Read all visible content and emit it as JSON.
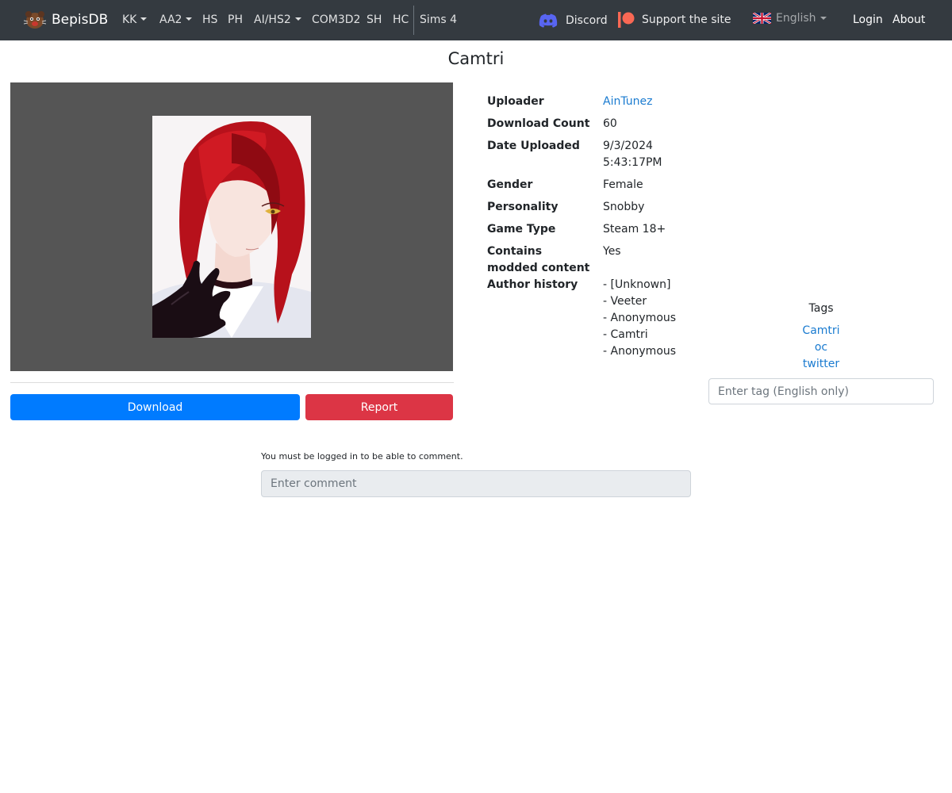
{
  "navbar": {
    "brand": "BepisDB",
    "items": [
      {
        "label": "KK",
        "dropdown": true
      },
      {
        "label": "AA2",
        "dropdown": true
      },
      {
        "label": "HS",
        "dropdown": false
      },
      {
        "label": "PH",
        "dropdown": false
      },
      {
        "label": "AI/HS2",
        "dropdown": true
      },
      {
        "label": "COM3D2",
        "dropdown": false
      },
      {
        "label": "SH",
        "dropdown": false
      },
      {
        "label": "HC",
        "dropdown": false
      },
      {
        "label": "Sims 4",
        "dropdown": false
      }
    ],
    "discord_label": "Discord",
    "support_label": "Support the site",
    "language": "English",
    "login_label": "Login",
    "about_label": "About"
  },
  "card": {
    "title": "Camtri",
    "download_label": "Download",
    "report_label": "Report"
  },
  "details": [
    {
      "label": "Uploader",
      "value": [
        "AinTunez"
      ],
      "link": true
    },
    {
      "label": "Download Count",
      "value": [
        "60"
      ]
    },
    {
      "label": "Date Uploaded",
      "value": [
        "9/3/2024",
        "5:43:17PM"
      ]
    },
    {
      "label": "Gender",
      "value": [
        "Female"
      ]
    },
    {
      "label": "Personality",
      "value": [
        "Snobby"
      ]
    },
    {
      "label": "Game Type",
      "value": [
        "Steam 18+"
      ]
    },
    {
      "label": "Contains modded content",
      "value": [
        "Yes"
      ]
    },
    {
      "label": "Author history",
      "value": [
        "- [Unknown]",
        "- Veeter",
        "- Anonymous",
        "- Camtri",
        "- Anonymous"
      ]
    }
  ],
  "tags": {
    "title": "Tags",
    "items": [
      "Camtri",
      "oc",
      "twitter"
    ],
    "input_placeholder": "Enter tag (English only)"
  },
  "comments": {
    "note": "You must be logged in to be able to comment.",
    "input_placeholder": "Enter comment"
  },
  "colors": {
    "navbar_bg": "#343a40",
    "primary": "#007bff",
    "danger": "#dc3545",
    "link": "#1a7bd0",
    "image_panel_bg": "#555555"
  }
}
